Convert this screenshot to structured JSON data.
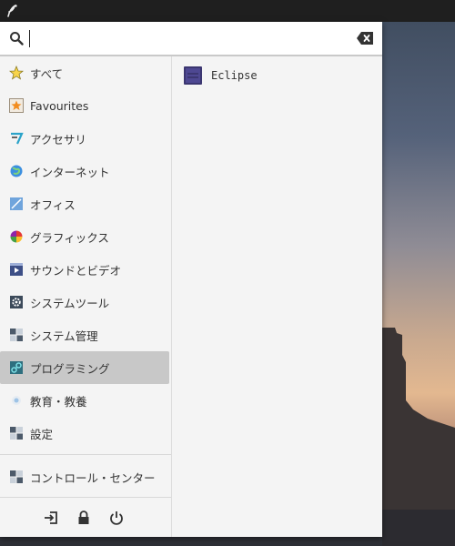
{
  "search": {
    "value": "",
    "placeholder": ""
  },
  "categories": [
    {
      "label": "すべて",
      "icon": "star-icon"
    },
    {
      "label": "Favourites",
      "icon": "favourites-icon"
    },
    {
      "label": "アクセサリ",
      "icon": "accessories-icon"
    },
    {
      "label": "インターネット",
      "icon": "internet-icon"
    },
    {
      "label": "オフィス",
      "icon": "office-icon"
    },
    {
      "label": "グラフィックス",
      "icon": "graphics-icon"
    },
    {
      "label": "サウンドとビデオ",
      "icon": "multimedia-icon"
    },
    {
      "label": "システムツール",
      "icon": "system-tools-icon"
    },
    {
      "label": "システム管理",
      "icon": "system-admin-icon"
    },
    {
      "label": "プログラミング",
      "icon": "programming-icon",
      "selected": true
    },
    {
      "label": "教育・教養",
      "icon": "education-icon"
    },
    {
      "label": "設定",
      "icon": "settings-icon"
    }
  ],
  "control_center": {
    "label": "コントロール・センター",
    "icon": "control-center-icon"
  },
  "actions": [
    {
      "icon": "logout-icon"
    },
    {
      "icon": "lock-icon"
    },
    {
      "icon": "power-icon"
    }
  ],
  "apps": [
    {
      "label": "Eclipse",
      "icon": "eclipse-icon"
    }
  ],
  "colors": {
    "selected": "#c8c8c8",
    "menu_bg": "#f4f4f4",
    "topbar": "#1f1f1f"
  }
}
